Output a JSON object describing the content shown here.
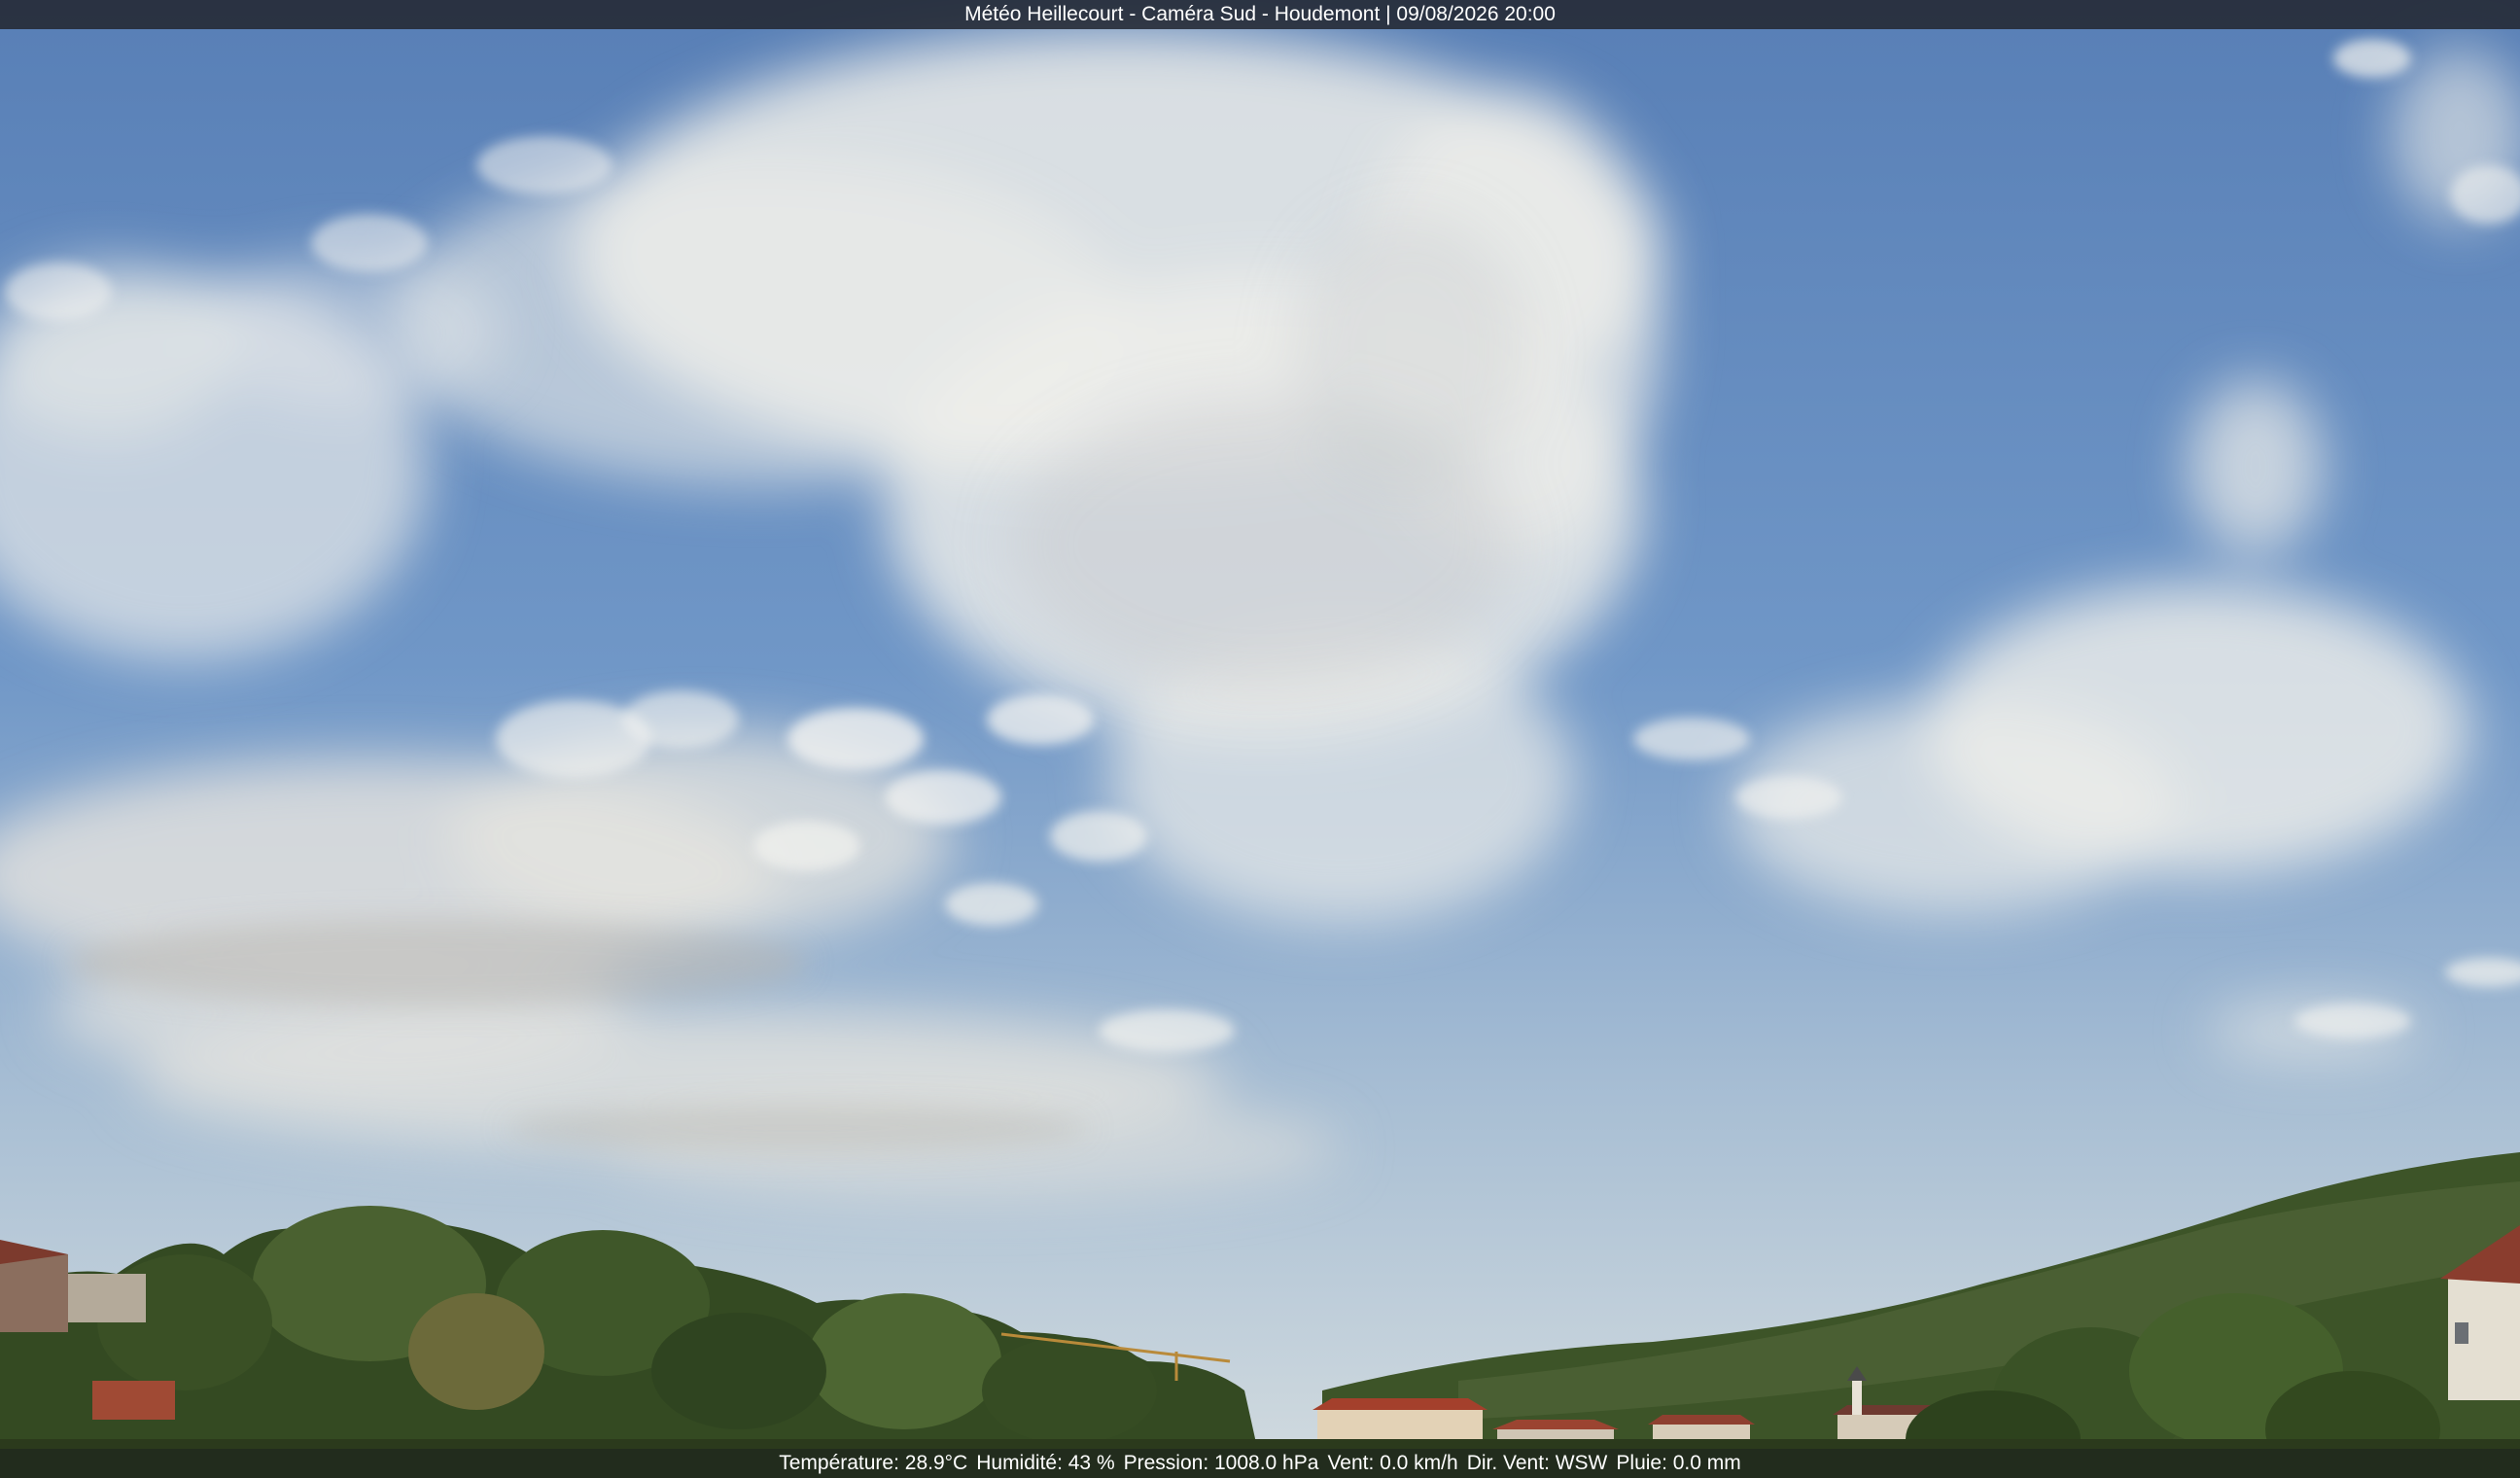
{
  "caption": {
    "title": "Météo Heillecourt - Caméra Sud - Houdemont | 09/08/2026 20:00"
  },
  "readings": {
    "temperature": "Température: 28.9°C",
    "humidity": "Humidité: 43 %",
    "pressure": "Pression: 1008.0 hPa",
    "wind": "Vent: 0.0 km/h",
    "wind_dir": "Dir. Vent: WSW",
    "rain": "Pluie: 0.0 mm"
  },
  "colors": {
    "sky_top": "#5f86bd",
    "sky_horizon": "#c9d6df",
    "cloud": "#f1f1ee",
    "foliage": "#3c5326",
    "roof": "#9a4d3a"
  }
}
